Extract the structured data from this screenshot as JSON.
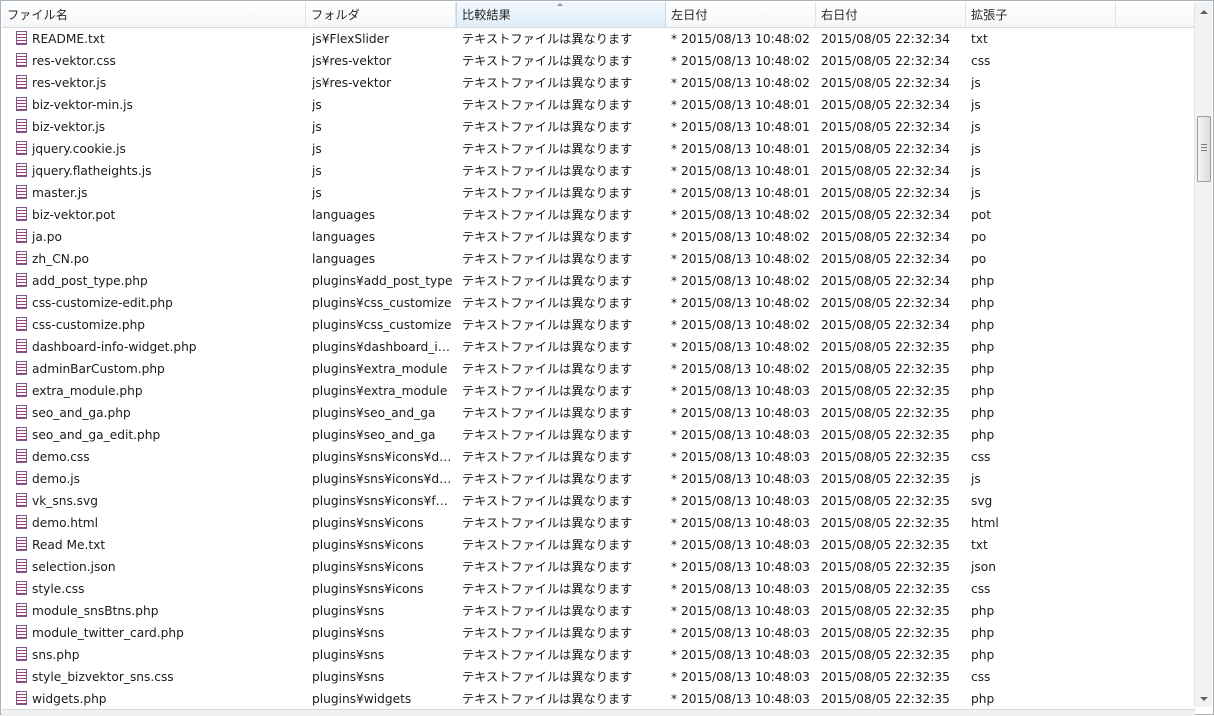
{
  "columns": [
    {
      "key": "name",
      "label": "ファイル名"
    },
    {
      "key": "folder",
      "label": "フォルダ"
    },
    {
      "key": "result",
      "label": "比較結果"
    },
    {
      "key": "left",
      "label": "左日付"
    },
    {
      "key": "right",
      "label": "右日付"
    },
    {
      "key": "ext",
      "label": "拡張子"
    }
  ],
  "rows": [
    {
      "name": "README.txt",
      "folder": "js¥FlexSlider",
      "result": "テキストファイルは異なります",
      "left": "* 2015/08/13 10:48:02",
      "right": "2015/08/05 22:32:34",
      "ext": "txt"
    },
    {
      "name": "res-vektor.css",
      "folder": "js¥res-vektor",
      "result": "テキストファイルは異なります",
      "left": "* 2015/08/13 10:48:02",
      "right": "2015/08/05 22:32:34",
      "ext": "css"
    },
    {
      "name": "res-vektor.js",
      "folder": "js¥res-vektor",
      "result": "テキストファイルは異なります",
      "left": "* 2015/08/13 10:48:02",
      "right": "2015/08/05 22:32:34",
      "ext": "js"
    },
    {
      "name": "biz-vektor-min.js",
      "folder": "js",
      "result": "テキストファイルは異なります",
      "left": "* 2015/08/13 10:48:01",
      "right": "2015/08/05 22:32:34",
      "ext": "js"
    },
    {
      "name": "biz-vektor.js",
      "folder": "js",
      "result": "テキストファイルは異なります",
      "left": "* 2015/08/13 10:48:01",
      "right": "2015/08/05 22:32:34",
      "ext": "js"
    },
    {
      "name": "jquery.cookie.js",
      "folder": "js",
      "result": "テキストファイルは異なります",
      "left": "* 2015/08/13 10:48:01",
      "right": "2015/08/05 22:32:34",
      "ext": "js"
    },
    {
      "name": "jquery.flatheights.js",
      "folder": "js",
      "result": "テキストファイルは異なります",
      "left": "* 2015/08/13 10:48:01",
      "right": "2015/08/05 22:32:34",
      "ext": "js"
    },
    {
      "name": "master.js",
      "folder": "js",
      "result": "テキストファイルは異なります",
      "left": "* 2015/08/13 10:48:01",
      "right": "2015/08/05 22:32:34",
      "ext": "js"
    },
    {
      "name": "biz-vektor.pot",
      "folder": "languages",
      "result": "テキストファイルは異なります",
      "left": "* 2015/08/13 10:48:02",
      "right": "2015/08/05 22:32:34",
      "ext": "pot"
    },
    {
      "name": "ja.po",
      "folder": "languages",
      "result": "テキストファイルは異なります",
      "left": "* 2015/08/13 10:48:02",
      "right": "2015/08/05 22:32:34",
      "ext": "po"
    },
    {
      "name": "zh_CN.po",
      "folder": "languages",
      "result": "テキストファイルは異なります",
      "left": "* 2015/08/13 10:48:02",
      "right": "2015/08/05 22:32:34",
      "ext": "po"
    },
    {
      "name": "add_post_type.php",
      "folder": "plugins¥add_post_type",
      "result": "テキストファイルは異なります",
      "left": "* 2015/08/13 10:48:02",
      "right": "2015/08/05 22:32:34",
      "ext": "php"
    },
    {
      "name": "css-customize-edit.php",
      "folder": "plugins¥css_customize",
      "result": "テキストファイルは異なります",
      "left": "* 2015/08/13 10:48:02",
      "right": "2015/08/05 22:32:34",
      "ext": "php"
    },
    {
      "name": "css-customize.php",
      "folder": "plugins¥css_customize",
      "result": "テキストファイルは異なります",
      "left": "* 2015/08/13 10:48:02",
      "right": "2015/08/05 22:32:34",
      "ext": "php"
    },
    {
      "name": "dashboard-info-widget.php",
      "folder": "plugins¥dashboard_in...",
      "result": "テキストファイルは異なります",
      "left": "* 2015/08/13 10:48:02",
      "right": "2015/08/05 22:32:35",
      "ext": "php"
    },
    {
      "name": "adminBarCustom.php",
      "folder": "plugins¥extra_module",
      "result": "テキストファイルは異なります",
      "left": "* 2015/08/13 10:48:02",
      "right": "2015/08/05 22:32:35",
      "ext": "php"
    },
    {
      "name": "extra_module.php",
      "folder": "plugins¥extra_module",
      "result": "テキストファイルは異なります",
      "left": "* 2015/08/13 10:48:03",
      "right": "2015/08/05 22:32:35",
      "ext": "php"
    },
    {
      "name": "seo_and_ga.php",
      "folder": "plugins¥seo_and_ga",
      "result": "テキストファイルは異なります",
      "left": "* 2015/08/13 10:48:03",
      "right": "2015/08/05 22:32:35",
      "ext": "php"
    },
    {
      "name": "seo_and_ga_edit.php",
      "folder": "plugins¥seo_and_ga",
      "result": "テキストファイルは異なります",
      "left": "* 2015/08/13 10:48:03",
      "right": "2015/08/05 22:32:35",
      "ext": "php"
    },
    {
      "name": "demo.css",
      "folder": "plugins¥sns¥icons¥de...",
      "result": "テキストファイルは異なります",
      "left": "* 2015/08/13 10:48:03",
      "right": "2015/08/05 22:32:35",
      "ext": "css"
    },
    {
      "name": "demo.js",
      "folder": "plugins¥sns¥icons¥de...",
      "result": "テキストファイルは異なります",
      "left": "* 2015/08/13 10:48:03",
      "right": "2015/08/05 22:32:35",
      "ext": "js"
    },
    {
      "name": "vk_sns.svg",
      "folder": "plugins¥sns¥icons¥fonts",
      "result": "テキストファイルは異なります",
      "left": "* 2015/08/13 10:48:03",
      "right": "2015/08/05 22:32:35",
      "ext": "svg"
    },
    {
      "name": "demo.html",
      "folder": "plugins¥sns¥icons",
      "result": "テキストファイルは異なります",
      "left": "* 2015/08/13 10:48:03",
      "right": "2015/08/05 22:32:35",
      "ext": "html"
    },
    {
      "name": "Read Me.txt",
      "folder": "plugins¥sns¥icons",
      "result": "テキストファイルは異なります",
      "left": "* 2015/08/13 10:48:03",
      "right": "2015/08/05 22:32:35",
      "ext": "txt"
    },
    {
      "name": "selection.json",
      "folder": "plugins¥sns¥icons",
      "result": "テキストファイルは異なります",
      "left": "* 2015/08/13 10:48:03",
      "right": "2015/08/05 22:32:35",
      "ext": "json"
    },
    {
      "name": "style.css",
      "folder": "plugins¥sns¥icons",
      "result": "テキストファイルは異なります",
      "left": "* 2015/08/13 10:48:03",
      "right": "2015/08/05 22:32:35",
      "ext": "css"
    },
    {
      "name": "module_snsBtns.php",
      "folder": "plugins¥sns",
      "result": "テキストファイルは異なります",
      "left": "* 2015/08/13 10:48:03",
      "right": "2015/08/05 22:32:35",
      "ext": "php"
    },
    {
      "name": "module_twitter_card.php",
      "folder": "plugins¥sns",
      "result": "テキストファイルは異なります",
      "left": "* 2015/08/13 10:48:03",
      "right": "2015/08/05 22:32:35",
      "ext": "php"
    },
    {
      "name": "sns.php",
      "folder": "plugins¥sns",
      "result": "テキストファイルは異なります",
      "left": "* 2015/08/13 10:48:03",
      "right": "2015/08/05 22:32:35",
      "ext": "php"
    },
    {
      "name": "style_bizvektor_sns.css",
      "folder": "plugins¥sns",
      "result": "テキストファイルは異なります",
      "left": "* 2015/08/13 10:48:03",
      "right": "2015/08/05 22:32:35",
      "ext": "css"
    },
    {
      "name": "widgets.php",
      "folder": "plugins¥widgets",
      "result": "テキストファイルは異なります",
      "left": "* 2015/08/13 10:48:03",
      "right": "2015/08/05 22:32:35",
      "ext": "php"
    }
  ],
  "icons": {
    "file": "text-file-icon",
    "sort": "sort-ascending-icon",
    "scroll_up": "scroll-up-icon",
    "scroll_down": "scroll-down-icon"
  },
  "colors": {
    "header_border": "#dfe3e8",
    "sorted_header": "#dfeefa",
    "file_icon_accent": "#a04070"
  }
}
